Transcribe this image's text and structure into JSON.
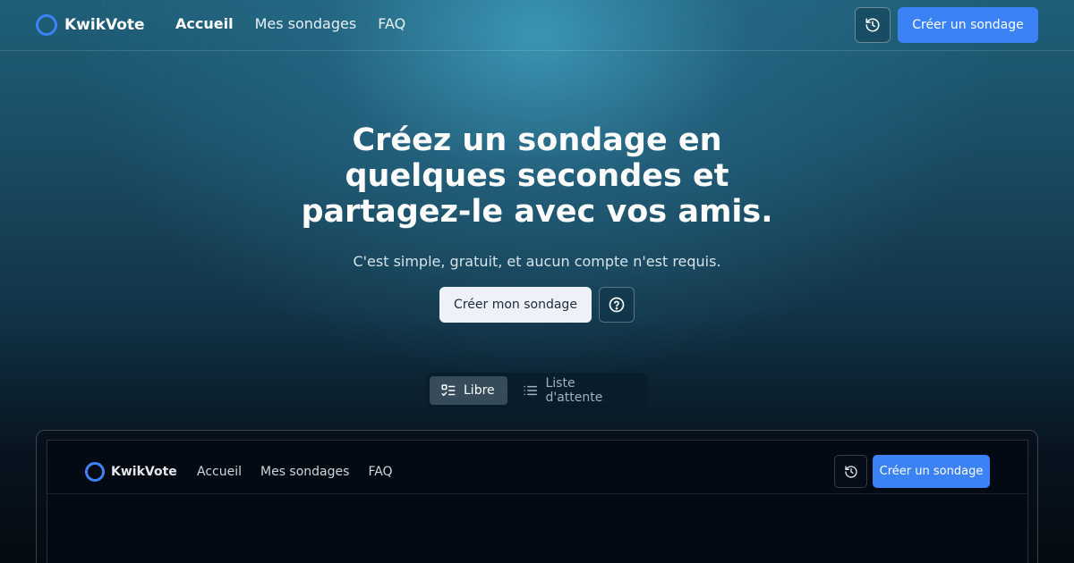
{
  "header": {
    "brand": "KwikVote",
    "nav": [
      {
        "label": "Accueil",
        "active": true
      },
      {
        "label": "Mes sondages",
        "active": false
      },
      {
        "label": "FAQ",
        "active": false
      }
    ],
    "history_icon": "history-icon",
    "create_button": "Créer un sondage"
  },
  "hero": {
    "title_lines": [
      "Créez un sondage en",
      "quelques secondes et",
      "partagez-le avec vos amis."
    ],
    "subtitle": "C'est simple, gratuit, et aucun compte n'est requis.",
    "primary_cta": "Créer mon sondage",
    "help_icon": "help-circle-icon"
  },
  "mode_toggle": {
    "options": [
      {
        "label": "Libre",
        "icon": "checklist-icon",
        "selected": true
      },
      {
        "label": "Liste d'attente",
        "icon": "list-icon",
        "selected": false
      }
    ]
  },
  "preview": {
    "brand": "KwikVote",
    "nav": [
      "Accueil",
      "Mes sondages",
      "FAQ"
    ],
    "create_button": "Créer un sondage"
  },
  "colors": {
    "accent": "#3b82f6",
    "light_button": "#eef2f8",
    "toggle_selected": "#374c5a"
  }
}
